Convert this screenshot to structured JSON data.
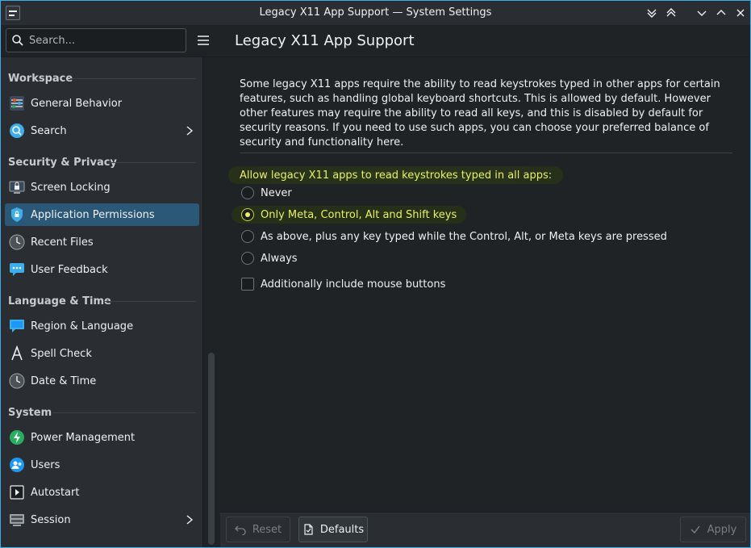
{
  "window": {
    "title": "Legacy X11 App Support — System Settings"
  },
  "header": {
    "search_placeholder": "Search...",
    "page_title": "Legacy X11 App Support"
  },
  "sidebar": {
    "sections": [
      {
        "title": "Workspace",
        "items": [
          {
            "label": "General Behavior",
            "icon": "general-behavior-icon"
          },
          {
            "label": "Search",
            "icon": "search-icon",
            "has_children": true
          }
        ]
      },
      {
        "title": "Security & Privacy",
        "items": [
          {
            "label": "Screen Locking",
            "icon": "screen-lock-icon"
          },
          {
            "label": "Application Permissions",
            "icon": "shield-lock-icon",
            "active": true
          },
          {
            "label": "Recent Files",
            "icon": "clock-icon"
          },
          {
            "label": "User Feedback",
            "icon": "feedback-icon"
          }
        ]
      },
      {
        "title": "Language & Time",
        "items": [
          {
            "label": "Region & Language",
            "icon": "region-icon"
          },
          {
            "label": "Spell Check",
            "icon": "spell-check-icon"
          },
          {
            "label": "Date & Time",
            "icon": "clock-icon"
          }
        ]
      },
      {
        "title": "System",
        "items": [
          {
            "label": "Power Management",
            "icon": "power-icon"
          },
          {
            "label": "Users",
            "icon": "users-icon"
          },
          {
            "label": "Autostart",
            "icon": "autostart-icon"
          },
          {
            "label": "Session",
            "icon": "session-icon",
            "has_children": true
          }
        ]
      }
    ]
  },
  "content": {
    "description": "Some legacy X11 apps require the ability to read keystrokes typed in other apps for certain features, such as handling global keyboard shortcuts. This is allowed by default. However other features may require the ability to read all keys, and this is disabled by default for security reasons. If you need to use such apps, you can choose your preferred balance of security and functionality here.",
    "group_label": "Allow legacy X11 apps to read keystrokes typed in all apps:",
    "options": [
      {
        "label": "Never",
        "checked": false
      },
      {
        "label": "Only Meta, Control, Alt and Shift keys",
        "checked": true
      },
      {
        "label": "As above, plus any key typed while the Control, Alt, or Meta keys are pressed",
        "checked": false
      },
      {
        "label": "Always",
        "checked": false
      }
    ],
    "mouse_checkbox": {
      "label": "Additionally include mouse buttons",
      "checked": false
    }
  },
  "footer": {
    "reset_label": "Reset",
    "defaults_label": "Defaults",
    "apply_label": "Apply"
  },
  "colors": {
    "accent": "#3daee9",
    "selection": "#2c5877",
    "highlight_text": "#e6f06a"
  }
}
